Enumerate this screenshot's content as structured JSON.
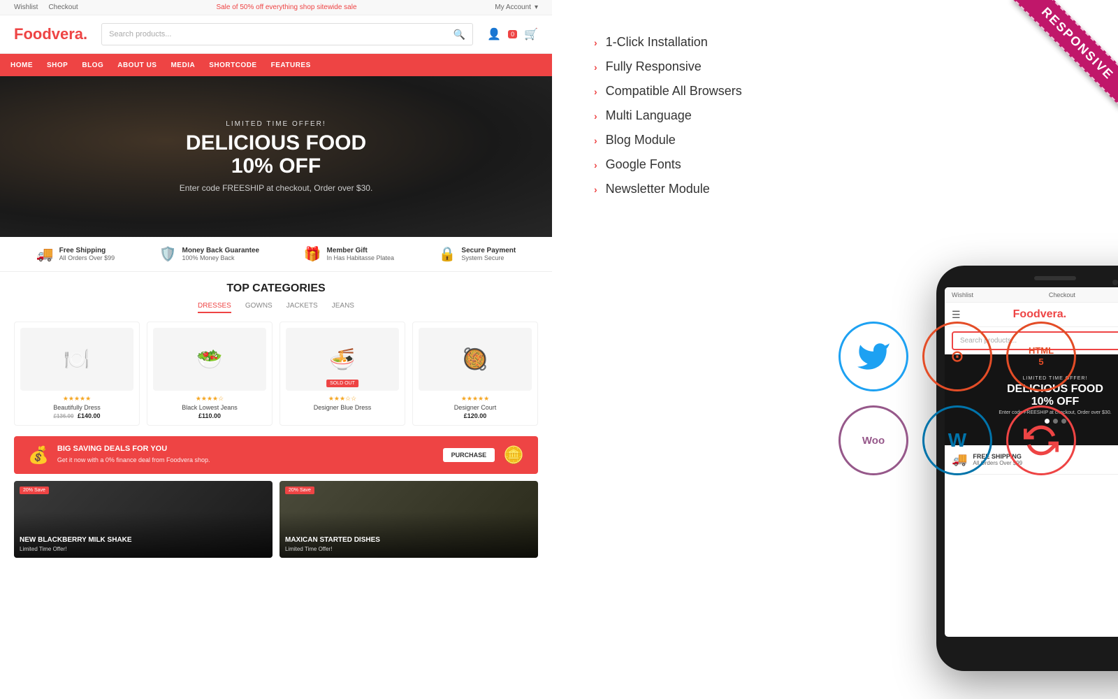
{
  "site": {
    "topbar": {
      "links": [
        "Wishlist",
        "Checkout"
      ],
      "promo": "Sale of 50% off everything shop sitewide sale",
      "account": "My Account"
    },
    "logo": "Foodvera",
    "logo_dot": ".",
    "search_placeholder": "Search products...",
    "nav_items": [
      "HOME",
      "SHOP",
      "BLOG",
      "ABOUT US",
      "MEDIA",
      "SHORTCODE",
      "FEATURES"
    ],
    "hero": {
      "limited": "LIMITED TIME OFFER!",
      "title": "DELICIOUS FOOD\n10% OFF",
      "subtitle": "Enter code FREESHIP at checkout, Order over $30."
    },
    "features": [
      {
        "icon": "🚚",
        "title": "Free Shipping",
        "sub": "All Orders Over $99"
      },
      {
        "icon": "🛡️",
        "title": "Money Back Guarantee",
        "sub": "100% Money Back"
      },
      {
        "icon": "🎁",
        "title": "Member Gift",
        "sub": "In Has Habitasse Platea"
      },
      {
        "icon": "🔒",
        "title": "Secure Payment",
        "sub": "System Secure"
      }
    ],
    "categories": {
      "title": "TOP CATEGORIES",
      "tabs": [
        "DRESSES",
        "GOWNS",
        "JACKETS",
        "JEANS"
      ],
      "active_tab": "DRESSES",
      "products": [
        {
          "name": "Beautifully Dress",
          "old_price": "£136.00",
          "price": "£140.00",
          "stars": "★★★★★",
          "sold_out": false
        },
        {
          "name": "Black Lowest Jeans",
          "price": "£110.00",
          "stars": "★★★★☆",
          "sold_out": false
        },
        {
          "name": "Designer Blue Dress",
          "price": "",
          "stars": "★★★☆☆",
          "sold_out": true
        },
        {
          "name": "Designer Court",
          "price": "£120.00",
          "stars": "★★★★★",
          "sold_out": false
        }
      ]
    },
    "promo_banner": {
      "title": "BIG SAVING DEALS FOR YOU",
      "sub": "Get it now with a 0% finance deal from Foodvera shop.",
      "btn": "PURCHASE"
    },
    "blog": [
      {
        "badge": "20% Save",
        "title": "NEW BLACKBERRY MILK SHAKE",
        "sub": "Limited Time Offer!"
      },
      {
        "badge": "20% Save",
        "title": "MAXICAN STARTED DISHES",
        "sub": "Limited Time Offer!"
      }
    ]
  },
  "features_list": {
    "items": [
      "1-Click Installation",
      "Fully Responsive",
      "Compatible All Browsers",
      "Multi Language",
      "Blog Module",
      "Google Fonts",
      "Newsletter Module"
    ]
  },
  "responsive_badge": "RESPONSIVE",
  "phone": {
    "topbar_links": [
      "Wishlist",
      "Checkout"
    ],
    "logo": "Foodvera",
    "search_placeholder": "Search products...",
    "hero": {
      "limited": "LIMITED TIME OFFER!",
      "title": "DELICIOUS FOOD\n10% OFF",
      "subtitle": "Enter code FREESHIP at checkout, Order over $30."
    },
    "feature": {
      "icon": "🚚",
      "title": "FREE SHIPPING",
      "sub": "All Orders Over $99"
    }
  },
  "tech": {
    "row1": [
      {
        "label": "🐦",
        "color_class": "tech-twitter",
        "title": "Twitter Bootstrap"
      },
      {
        "label": "⊙",
        "color_class": "tech-joomla",
        "title": "Joomla"
      },
      {
        "label": "5",
        "color_class": "tech-html5",
        "title": "HTML5"
      }
    ],
    "row2": [
      {
        "label": "Woo",
        "color_class": "tech-woo",
        "title": "WooCommerce"
      },
      {
        "label": "W",
        "color_class": "tech-wordpress",
        "title": "WordPress"
      },
      {
        "label": "↻",
        "color_class": "tech-refresh",
        "title": "Updates"
      }
    ]
  }
}
